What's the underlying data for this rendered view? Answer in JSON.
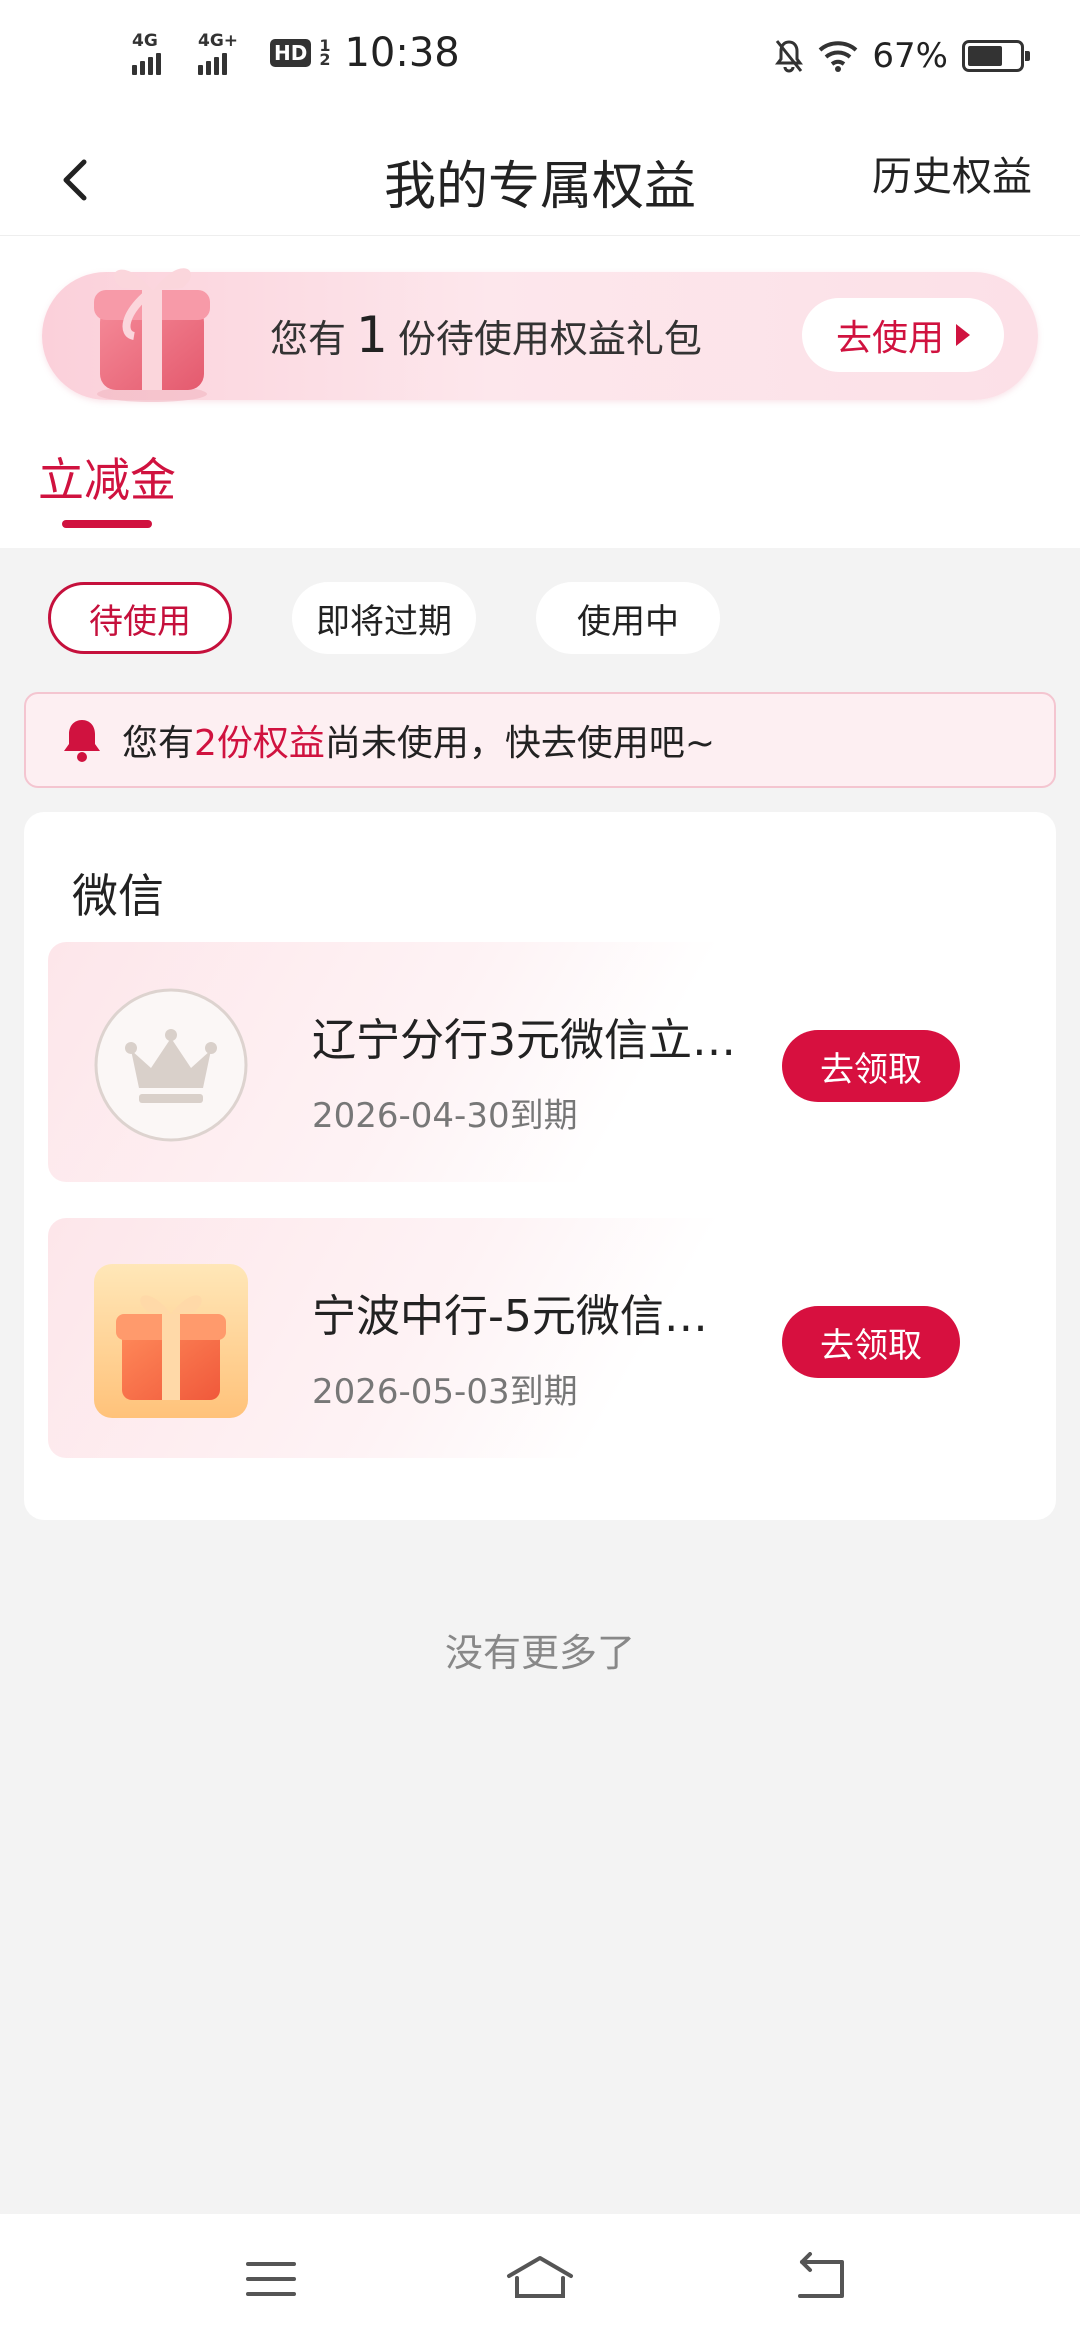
{
  "status_bar": {
    "network_1": "4G",
    "network_2": "4G+",
    "hd": "HD",
    "hd_sub_top": "1",
    "hd_sub_bottom": "2",
    "time": "10:38",
    "battery_text": "67%",
    "battery_level": 0.67
  },
  "nav": {
    "title": "我的专属权益",
    "history": "历史权益"
  },
  "banner": {
    "prefix": "您有",
    "count": "1",
    "suffix": "份待使用权益礼包",
    "button": "去使用"
  },
  "tabs": [
    {
      "label": "立减金"
    }
  ],
  "filters": [
    {
      "label": "待使用",
      "active": true
    },
    {
      "label": "即将过期",
      "active": false
    },
    {
      "label": "使用中",
      "active": false
    }
  ],
  "notice": {
    "prefix": "您有",
    "highlight": "2份权益",
    "suffix": "尚未使用，快去使用吧~"
  },
  "section": {
    "title": "微信",
    "items": [
      {
        "name": "辽宁分行3元微信立…",
        "date": "2026-04-30到期",
        "button": "去领取",
        "icon": "crown-icon"
      },
      {
        "name": "宁波中行-5元微信…",
        "date": "2026-05-03到期",
        "button": "去领取",
        "icon": "gift-box-icon"
      }
    ]
  },
  "footer": {
    "no_more": "没有更多了"
  },
  "colors": {
    "accent": "#d0123f",
    "background": "#f3f3f3"
  }
}
